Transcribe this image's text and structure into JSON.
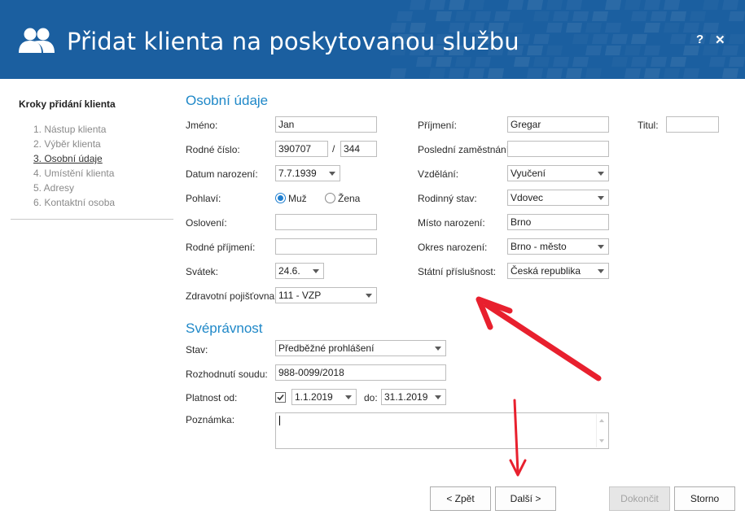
{
  "window": {
    "title": "Přidat klienta na poskytovanou službu",
    "help_label": "?",
    "close_label": "✕",
    "header_color": "#1b5fa0",
    "header_icon": "users-icon"
  },
  "sidebar": {
    "title": "Kroky přidání klienta",
    "steps": [
      {
        "label": "1. Nástup klienta"
      },
      {
        "label": "2. Výběr klienta"
      },
      {
        "label": "3. Osobní údaje"
      },
      {
        "label": "4. Umístění klienta"
      },
      {
        "label": "5. Adresy"
      },
      {
        "label": "6. Kontaktní osoba"
      }
    ],
    "active_step": 3
  },
  "osobni": {
    "heading": "Osobní údaje",
    "jmeno": {
      "label": "Jméno:",
      "value": "Jan"
    },
    "rodne_cislo": {
      "label": "Rodné číslo:",
      "value1": "390707",
      "separator": "/",
      "value2": "344"
    },
    "datum_narozeni": {
      "label": "Datum narození:",
      "value": "7.7.1939"
    },
    "pohlavi": {
      "label": "Pohlaví:",
      "option_muz": "Muž",
      "option_zena": "Žena",
      "selected": "Muž"
    },
    "osloveni": {
      "label": "Oslovení:",
      "value": ""
    },
    "rodne_prijmeni": {
      "label": "Rodné příjmení:",
      "value": ""
    },
    "svatek": {
      "label": "Svátek:",
      "value": "24.6."
    },
    "pojistovna": {
      "label": "Zdravotní pojišťovna:",
      "value": "111 - VZP"
    },
    "prijmeni": {
      "label": "Příjmení:",
      "value": "Gregar"
    },
    "titul": {
      "label": "Titul:",
      "value": ""
    },
    "posledni_zamestnani": {
      "label": "Poslední zaměstnání:",
      "value": ""
    },
    "vzdelani": {
      "label": "Vzdělání:",
      "value": "Vyučení"
    },
    "rodinny_stav": {
      "label": "Rodinný stav:",
      "value": "Vdovec"
    },
    "misto_narozeni": {
      "label": "Místo narození:",
      "value": "Brno"
    },
    "okres_narozeni": {
      "label": "Okres narození:",
      "value": "Brno - město"
    },
    "statni_prislusnost": {
      "label": "Státní příslušnost:",
      "value": "Česká republika"
    }
  },
  "svepravnost": {
    "heading": "Svéprávnost",
    "stav": {
      "label": "Stav:",
      "value": "Předběžné prohlášení"
    },
    "rozhodnuti": {
      "label": "Rozhodnutí soudu:",
      "value": "988-0099/2018"
    },
    "platnost_od": {
      "label": "Platnost od:",
      "checked": true,
      "value": "1.1.2019"
    },
    "platnost_do": {
      "label": "do:",
      "value": "31.1.2019"
    },
    "poznamka": {
      "label": "Poznámka:",
      "value": ""
    }
  },
  "buttons": {
    "back": "< Zpět",
    "next": "Další >",
    "finish": "Dokončit",
    "cancel": "Storno"
  },
  "colors": {
    "accent": "#1f88c8",
    "annotation_arrow": "#e8202e"
  }
}
